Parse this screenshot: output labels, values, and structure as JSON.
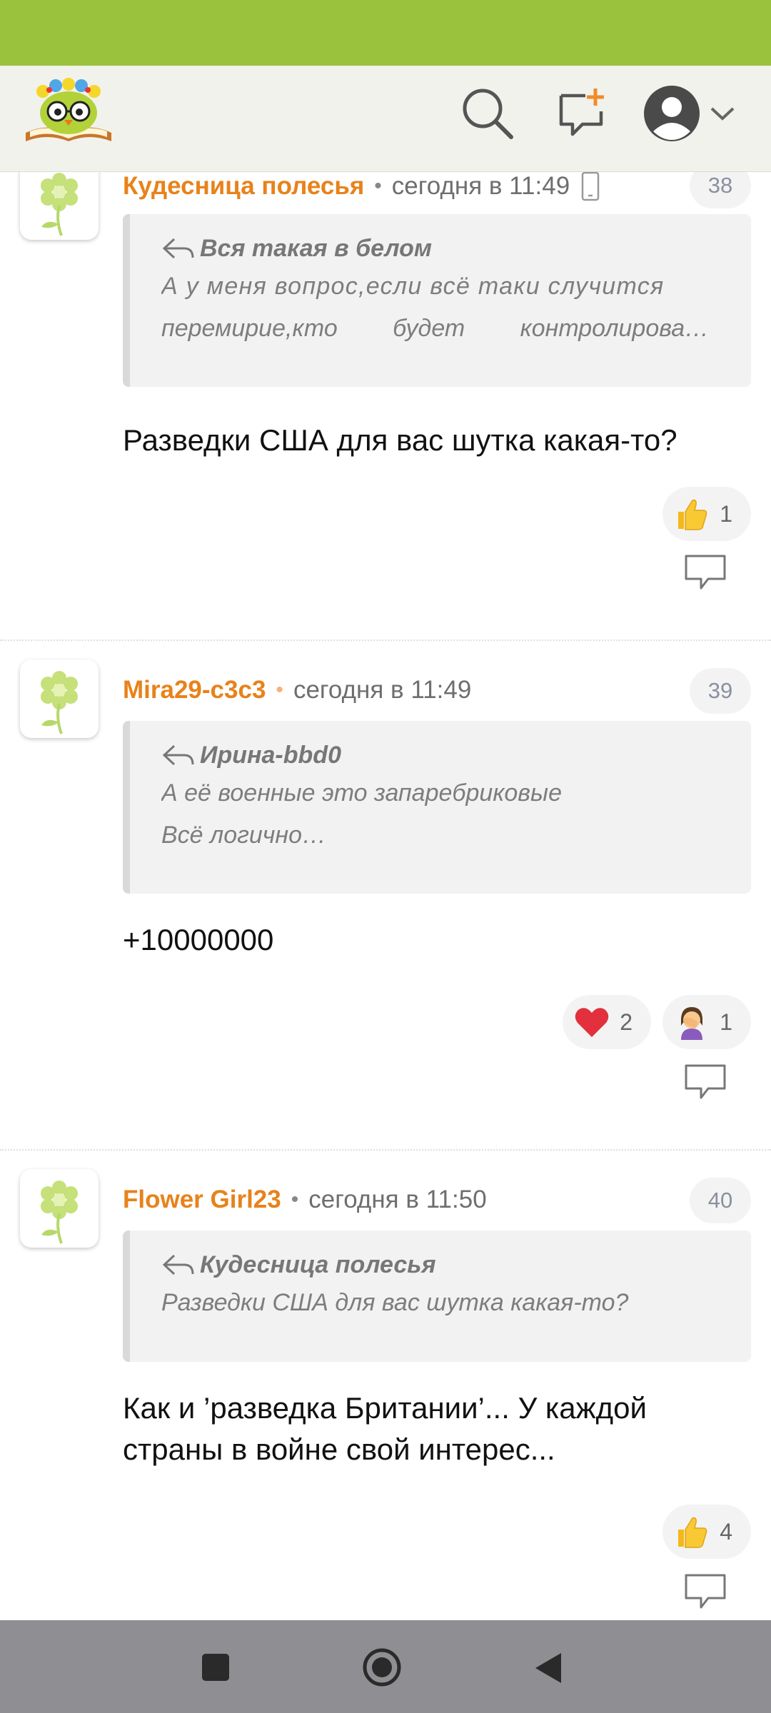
{
  "header": {
    "logo": "owl-reading-book-logo",
    "icons": [
      "search-icon",
      "new-message-icon",
      "user-avatar-icon",
      "chevron-down-icon"
    ]
  },
  "comments": [
    {
      "author": "Кудесница полесья",
      "time": "сегодня в 11:49",
      "number": "38",
      "quote_author": "Вся такая в белом",
      "quote_lines": [
        "А у меня вопрос,если всё таки случится",
        "перемирие,кто будет контролирова…"
      ],
      "text": "Разведки США для вас шутка какая-то?",
      "reactions": [
        {
          "icon": "thumbs-up",
          "count": "1"
        }
      ]
    },
    {
      "author": "Mira29-c3c3",
      "time": "сегодня в 11:49",
      "number": "39",
      "quote_author": "Ирина-bbd0",
      "quote_lines": [
        "А её военные это запаребриковые",
        "Всё логично…"
      ],
      "text": "+10000000",
      "reactions": [
        {
          "icon": "heart",
          "count": "2"
        },
        {
          "icon": "facepalm",
          "count": "1"
        }
      ]
    },
    {
      "author": "Flower Girl23",
      "time": "сегодня в 11:50",
      "number": "40",
      "quote_author": "Кудесница полесья",
      "quote_lines": [
        "Разведки США для вас шутка какая-то?"
      ],
      "text": "Как и ’разведка Британии’... У каждой страны в войне свой интерес...",
      "reactions": [
        {
          "icon": "thumbs-up",
          "count": "4"
        }
      ]
    }
  ],
  "colors": {
    "statusbar": "#9bc23c",
    "author": "#e8821a",
    "header_bg": "#f1f2ec",
    "navbar": "#8e8e93"
  }
}
